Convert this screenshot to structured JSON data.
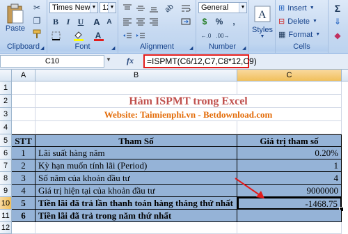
{
  "ribbon": {
    "clipboard": {
      "label": "Clipboard",
      "paste_label": "Paste"
    },
    "font": {
      "label": "Font",
      "font_name": "Times New Ro",
      "font_size": "12",
      "bold": "B",
      "italic": "I",
      "underline": "U",
      "grow": "A",
      "shrink": "A",
      "font_color_glyph": "A"
    },
    "alignment": {
      "label": "Alignment"
    },
    "number": {
      "label": "Number",
      "format": "General",
      "currency": "$",
      "percent": "%",
      "comma": ","
    },
    "styles": {
      "label": "Styles"
    },
    "cells": {
      "label": "Cells",
      "insert": "Insert",
      "delete": "Delete",
      "format": "Format"
    },
    "editing": {
      "sum_glyph": "Σ"
    },
    "colors": {
      "font_color": "#e31b1b",
      "fill_color": "#ffff00"
    }
  },
  "formula_bar": {
    "name_box": "C10",
    "fx": "fx",
    "formula": "=ISPMT(C6/12,C7,C8*12,C9)"
  },
  "columns": [
    "A",
    "B",
    "C"
  ],
  "selected_column": "C",
  "rows": [
    "1",
    "2",
    "3",
    "4",
    "5",
    "6",
    "7",
    "8",
    "9",
    "10",
    "11",
    "12"
  ],
  "selected_row": "10",
  "sheet": {
    "title": "Hàm ISPMT trong Excel",
    "website": "Website: Taimienphi.vn - Betdownload.com",
    "headers": {
      "stt": "STT",
      "param": "Tham Số",
      "value": "Giá trị tham số"
    },
    "table": [
      {
        "stt": "1",
        "param": "Lãi suất hàng năm",
        "value": "0.20%"
      },
      {
        "stt": "2",
        "param": "Kỳ hạn muốn tính lãi (Period)",
        "value": "1"
      },
      {
        "stt": "3",
        "param": "Số năm của khoản đầu tư",
        "value": "4"
      },
      {
        "stt": "4",
        "param": "Giá trị hiện tại của khoản đầu tư",
        "value": "9000000"
      },
      {
        "stt": "5",
        "param": "Tiền lãi đã trả lần thanh toán hàng tháng thứ nhất",
        "value": "-1468.75"
      },
      {
        "stt": "6",
        "param": "Tiền lãi đã trả trong năm thứ nhất",
        "value": ""
      }
    ],
    "colors": {
      "title": "#c0504d",
      "website": "#e36c09",
      "table_fill": "#95b3d7",
      "arrow": "#e21b1b"
    }
  }
}
